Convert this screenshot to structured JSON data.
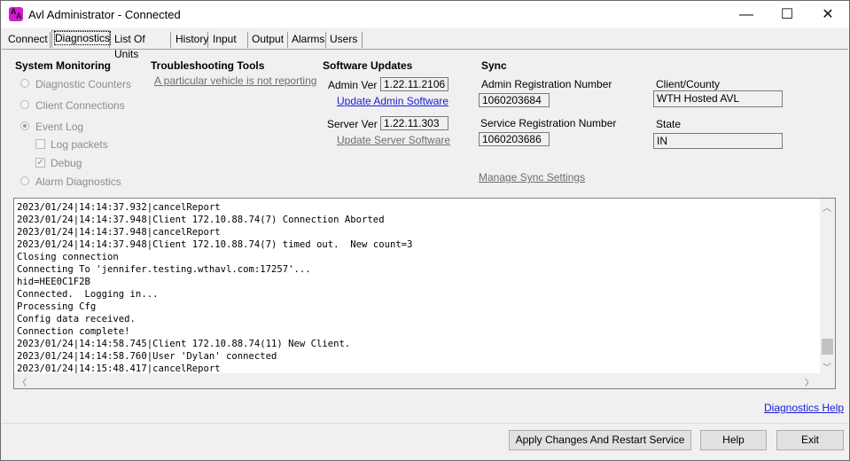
{
  "window": {
    "title": "Avl Administrator - Connected",
    "icon_glyph_1": "A",
    "icon_glyph_2": "A",
    "minimize": "—",
    "maximize": "☐",
    "close": "✕",
    "accent": "#d11bd1"
  },
  "tabs": [
    "Connect",
    "Diagnostics",
    "List Of Units",
    "History",
    "Input",
    "Output",
    "Alarms",
    "Users"
  ],
  "active_tab": "Diagnostics",
  "system_monitoring": {
    "heading": "System Monitoring",
    "diagnostic_counters": "Diagnostic Counters",
    "client_connections": "Client Connections",
    "event_log": "Event Log",
    "log_packets": "Log packets",
    "debug": "Debug",
    "alarm_diagnostics": "Alarm Diagnostics",
    "event_log_selected": true,
    "log_packets_checked": false,
    "debug_checked": true
  },
  "troubleshooting": {
    "heading": "Troubleshooting Tools",
    "vehicle_link": "A particular vehicle is not reporting"
  },
  "software_updates": {
    "heading": "Software Updates",
    "admin_ver_label": "Admin Ver",
    "admin_ver_value": "1.22.11.2106",
    "update_admin_link": "Update Admin Software",
    "server_ver_label": "Server Ver",
    "server_ver_value": "1.22.11.303",
    "update_server_link": "Update Server Software"
  },
  "sync": {
    "heading": "Sync",
    "admin_reg_label": "Admin Registration Number",
    "admin_reg_value": "1060203684",
    "service_reg_label": "Service Registration Number",
    "service_reg_value": "1060203686",
    "client_county_label": "Client/County",
    "client_county_value": "WTH Hosted AVL",
    "state_label": "State",
    "state_value": "IN",
    "manage_link": "Manage Sync Settings"
  },
  "log": [
    "2023/01/24|14:14:37.932|cancelReport",
    "2023/01/24|14:14:37.948|Client 172.10.88.74(7) Connection Aborted",
    "2023/01/24|14:14:37.948|cancelReport",
    "2023/01/24|14:14:37.948|Client 172.10.88.74(7) timed out.  New count=3",
    "Closing connection",
    "Connecting To 'jennifer.testing.wthavl.com:17257'...",
    "hid=HEE0C1F2B",
    "Connected.  Logging in...",
    "Processing Cfg",
    "Config data received.",
    "Connection complete!",
    "2023/01/24|14:14:58.745|Client 172.10.88.74(11) New Client.",
    "2023/01/24|14:14:58.760|User 'Dylan' connected",
    "2023/01/24|14:15:48.417|cancelReport"
  ],
  "scroll": {
    "up": "︿",
    "down": "﹀",
    "left": "〈",
    "right": "〉"
  },
  "diagnostics_help": "Diagnostics Help",
  "buttons": {
    "apply": "Apply Changes And Restart Service",
    "help": "Help",
    "exit": "Exit"
  }
}
